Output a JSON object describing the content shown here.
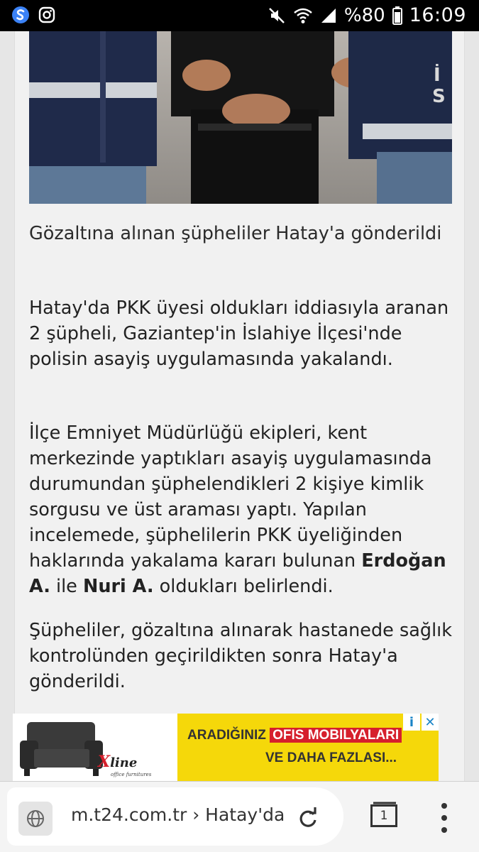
{
  "status_bar": {
    "left_icons": [
      "s-app-icon",
      "instagram-icon"
    ],
    "right_icons": [
      "mute-icon",
      "wifi-icon",
      "signal-icon"
    ],
    "battery": "%80",
    "time": "16:09"
  },
  "article": {
    "photo_caption": "Gözaltına alınan şüpheliler Hatay'a gönderildi",
    "paragraph_1": "Hatay'da PKK üyesi oldukları iddiasıyla aranan 2 şüpheli, Gaziantep'in İslahiye İlçesi'nde polisin asayiş uygulamasında yakalandı.",
    "paragraph_2_start": "İlçe Emniyet Müdürlüğü ekipleri, kent merkezinde yaptıkları asayiş uygulamasında durumundan şüphelendikleri 2 kişiye kimlik sorgusu ve üst araması yaptı. Yapılan incelemede, şüphelilerin PKK üyeliğinden haklarında yakalama kararı bulunan ",
    "paragraph_2_name1": "Erdoğan A.",
    "paragraph_2_mid": " ile ",
    "paragraph_2_name2": "Nuri A.",
    "paragraph_2_end": " oldukları belirlendi.",
    "paragraph_3": "Şüpheliler, gözaltına alınarak hastanede sağlık kontrolünden geçirildikten sonra Hatay'a gönderildi."
  },
  "ad": {
    "line1_prefix": "ARADIĞINIZ",
    "line1_highlight": "OFIS MOBILYALARI",
    "line2": "VE DAHA FAZLASI...",
    "logo_x": "X",
    "logo_rest": "line",
    "logo_sub": "office furnitures",
    "info_glyph": "i",
    "close_glyph": "✕"
  },
  "browser": {
    "url": "m.t24.com.tr › Hatay'da",
    "tab_count": "1"
  }
}
